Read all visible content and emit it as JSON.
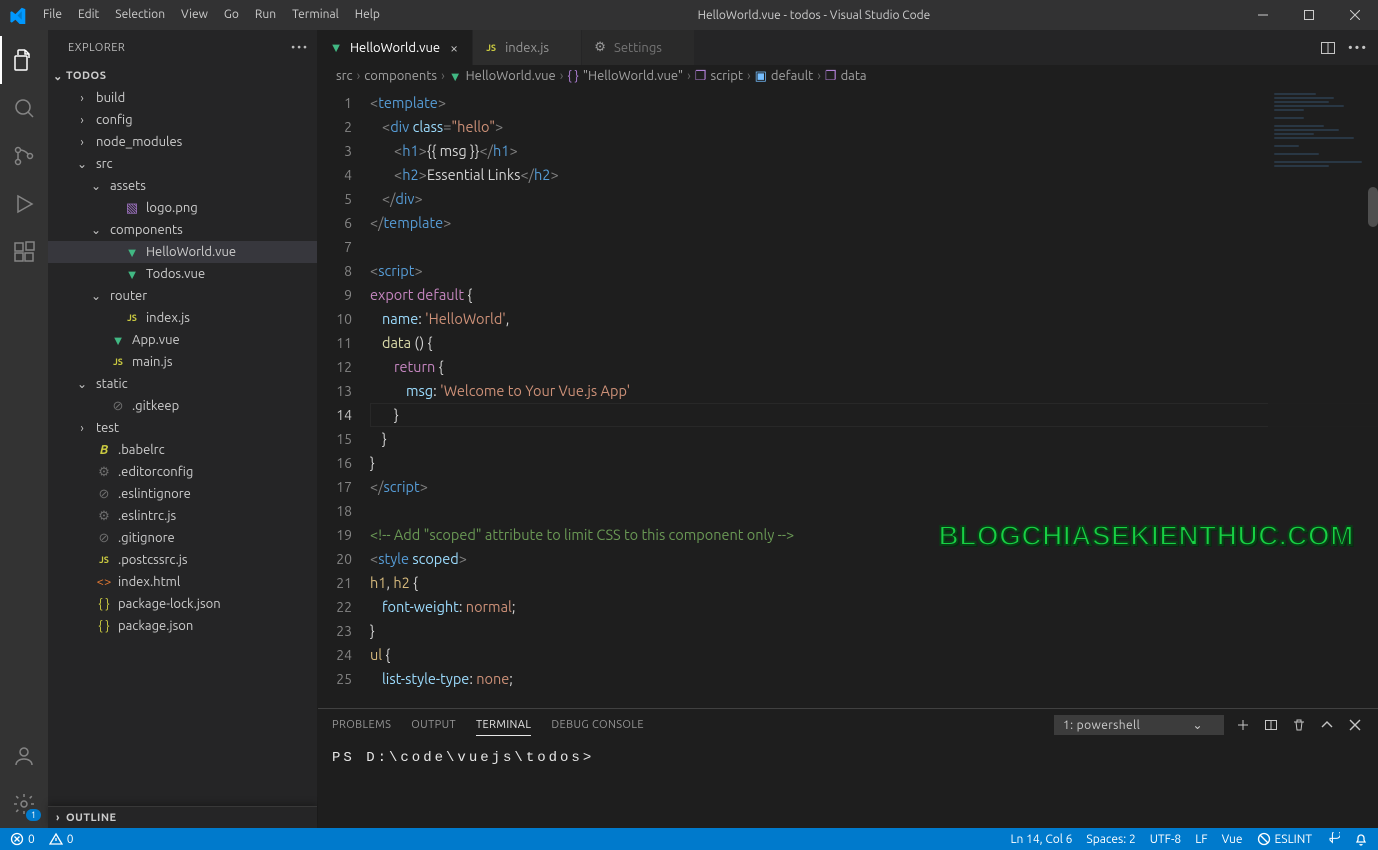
{
  "window": {
    "title": "HelloWorld.vue - todos - Visual Studio Code",
    "menu": [
      "File",
      "Edit",
      "Selection",
      "View",
      "Go",
      "Run",
      "Terminal",
      "Help"
    ]
  },
  "activity": {
    "items": [
      "explorer",
      "search",
      "scm",
      "debug",
      "extensions"
    ],
    "bottom": [
      "account",
      "manage"
    ],
    "badge": "1"
  },
  "explorer": {
    "title": "EXPLORER",
    "root": "TODOS",
    "outline": "OUTLINE",
    "tree": [
      {
        "depth": 1,
        "chev": "›",
        "icon": "folder",
        "label": "build"
      },
      {
        "depth": 1,
        "chev": "›",
        "icon": "folder",
        "label": "config"
      },
      {
        "depth": 1,
        "chev": "›",
        "icon": "folder",
        "label": "node_modules"
      },
      {
        "depth": 1,
        "chev": "⌄",
        "icon": "folder",
        "label": "src"
      },
      {
        "depth": 2,
        "chev": "⌄",
        "icon": "folder",
        "label": "assets"
      },
      {
        "depth": 3,
        "chev": "",
        "icon": "img",
        "label": "logo.png"
      },
      {
        "depth": 2,
        "chev": "⌄",
        "icon": "folder",
        "label": "components"
      },
      {
        "depth": 3,
        "chev": "",
        "icon": "vue",
        "label": "HelloWorld.vue",
        "selected": true
      },
      {
        "depth": 3,
        "chev": "",
        "icon": "vue",
        "label": "Todos.vue"
      },
      {
        "depth": 2,
        "chev": "⌄",
        "icon": "folder",
        "label": "router"
      },
      {
        "depth": 3,
        "chev": "",
        "icon": "js",
        "label": "index.js"
      },
      {
        "depth": 2,
        "chev": "",
        "icon": "vue",
        "label": "App.vue"
      },
      {
        "depth": 2,
        "chev": "",
        "icon": "js",
        "label": "main.js"
      },
      {
        "depth": 1,
        "chev": "⌄",
        "icon": "folder",
        "label": "static"
      },
      {
        "depth": 2,
        "chev": "",
        "icon": "ban",
        "label": ".gitkeep"
      },
      {
        "depth": 1,
        "chev": "›",
        "icon": "folder",
        "label": "test"
      },
      {
        "depth": 1,
        "chev": "",
        "icon": "babel",
        "label": ".babelrc"
      },
      {
        "depth": 1,
        "chev": "",
        "icon": "gear",
        "label": ".editorconfig"
      },
      {
        "depth": 1,
        "chev": "",
        "icon": "ban",
        "label": ".eslintignore"
      },
      {
        "depth": 1,
        "chev": "",
        "icon": "gear",
        "label": ".eslintrc.js"
      },
      {
        "depth": 1,
        "chev": "",
        "icon": "ban",
        "label": ".gitignore"
      },
      {
        "depth": 1,
        "chev": "",
        "icon": "js",
        "label": ".postcssrc.js"
      },
      {
        "depth": 1,
        "chev": "",
        "icon": "html",
        "label": "index.html"
      },
      {
        "depth": 1,
        "chev": "",
        "icon": "json",
        "label": "package-lock.json"
      },
      {
        "depth": 1,
        "chev": "",
        "icon": "json",
        "label": "package.json"
      }
    ]
  },
  "tabs": [
    {
      "icon": "vue",
      "label": "HelloWorld.vue",
      "active": true
    },
    {
      "icon": "js",
      "label": "index.js",
      "active": false
    },
    {
      "icon": "gear",
      "label": "Settings",
      "active": false,
      "settings": true
    }
  ],
  "breadcrumbs": [
    {
      "icon": "",
      "label": "src"
    },
    {
      "icon": "",
      "label": "components"
    },
    {
      "icon": "vue",
      "label": "HelloWorld.vue"
    },
    {
      "icon": "braces",
      "label": "\"HelloWorld.vue\""
    },
    {
      "icon": "cube",
      "label": "script"
    },
    {
      "icon": "object",
      "label": "default"
    },
    {
      "icon": "cube",
      "label": "data"
    }
  ],
  "editor": {
    "current_line": 14,
    "lines": [
      {
        "n": 1,
        "html": "<span class='tg'>&lt;</span><span class='tn'>template</span><span class='tg'>&gt;</span>"
      },
      {
        "n": 2,
        "html": "<span class='ind' style='width:12px'></span><span class='tg'>&lt;</span><span class='tn'>div</span> <span class='attr'>class</span><span class='tg'>=</span><span class='str'>\"hello\"</span><span class='tg'>&gt;</span>"
      },
      {
        "n": 3,
        "html": "<span class='ind' style='width:24px'></span><span class='tg'>&lt;</span><span class='tn'>h1</span><span class='tg'>&gt;</span><span class='mus'>{{ msg }}</span><span class='tg'>&lt;/</span><span class='tn'>h1</span><span class='tg'>&gt;</span>"
      },
      {
        "n": 4,
        "html": "<span class='ind' style='width:24px'></span><span class='tg'>&lt;</span><span class='tn'>h2</span><span class='tg'>&gt;</span><span class='txt'>Essential Links</span><span class='tg'>&lt;/</span><span class='tn'>h2</span><span class='tg'>&gt;</span>"
      },
      {
        "n": 5,
        "html": "<span class='ind' style='width:12px'></span><span class='tg'>&lt;/</span><span class='tn'>div</span><span class='tg'>&gt;</span>"
      },
      {
        "n": 6,
        "html": "<span class='tg'>&lt;/</span><span class='tn'>template</span><span class='tg'>&gt;</span>"
      },
      {
        "n": 7,
        "html": ""
      },
      {
        "n": 8,
        "html": "<span class='tg'>&lt;</span><span class='tn'>script</span><span class='tg'>&gt;</span>"
      },
      {
        "n": 9,
        "html": "<span class='kw'>export</span> <span class='kw'>default</span> <span class='txt'>{</span>"
      },
      {
        "n": 10,
        "html": "<span class='ind' style='width:12px'></span><span class='id'>name</span><span class='txt'>:</span> <span class='str'>'HelloWorld'</span><span class='txt'>,</span>"
      },
      {
        "n": 11,
        "html": "<span class='ind' style='width:12px'></span><span class='fn'>data</span> <span class='txt'>() {</span>"
      },
      {
        "n": 12,
        "html": "<span class='ind' style='width:24px'></span><span class='kw'>return</span> <span class='txt'>{</span>"
      },
      {
        "n": 13,
        "html": "<span class='ind' style='width:36px'></span><span class='id'>msg</span><span class='txt'>:</span> <span class='str'>'Welcome to Your Vue.js App'</span>"
      },
      {
        "n": 14,
        "html": "<span class='ind' style='width:24px'></span><span class='txt'>}</span>"
      },
      {
        "n": 15,
        "html": "<span class='ind' style='width:12px'></span><span class='txt'>}</span>"
      },
      {
        "n": 16,
        "html": "<span class='txt'>}</span>"
      },
      {
        "n": 17,
        "html": "<span class='tg'>&lt;/</span><span class='tn'>script</span><span class='tg'>&gt;</span>"
      },
      {
        "n": 18,
        "html": ""
      },
      {
        "n": 19,
        "html": "<span class='cmt'>&lt;!-- Add \"scoped\" attribute to limit CSS to this component only --&gt;</span>"
      },
      {
        "n": 20,
        "html": "<span class='tg'>&lt;</span><span class='tn'>style</span> <span class='attr'>scoped</span><span class='tg'>&gt;</span>"
      },
      {
        "n": 21,
        "html": "<span class='css-sel'>h1</span><span class='txt'>, </span><span class='css-sel'>h2</span> <span class='txt'>{</span>"
      },
      {
        "n": 22,
        "html": "<span class='ind' style='width:12px'></span><span class='css-prop'>font-weight</span><span class='txt'>: </span><span class='css-val'>normal</span><span class='txt'>;</span>"
      },
      {
        "n": 23,
        "html": "<span class='txt'>}</span>"
      },
      {
        "n": 24,
        "html": "<span class='css-sel'>ul</span> <span class='txt'>{</span>"
      },
      {
        "n": 25,
        "html": "<span class='ind' style='width:12px'></span><span class='css-prop'>list-style-type</span><span class='txt'>: </span><span class='css-val'>none</span><span class='txt'>;</span>"
      }
    ]
  },
  "panel": {
    "tabs": [
      "PROBLEMS",
      "OUTPUT",
      "TERMINAL",
      "DEBUG CONSOLE"
    ],
    "active_tab": 2,
    "terminal_select": "1: powershell",
    "terminal_line": "PS D:\\code\\vuejs\\todos>"
  },
  "status": {
    "errors": "0",
    "warnings": "0",
    "ln_col": "Ln 14, Col 6",
    "spaces": "Spaces: 2",
    "encoding": "UTF-8",
    "eol": "LF",
    "language": "Vue",
    "eslint": "ESLINT"
  },
  "watermark": "BLOGCHIASEKIENTHUC.COM"
}
